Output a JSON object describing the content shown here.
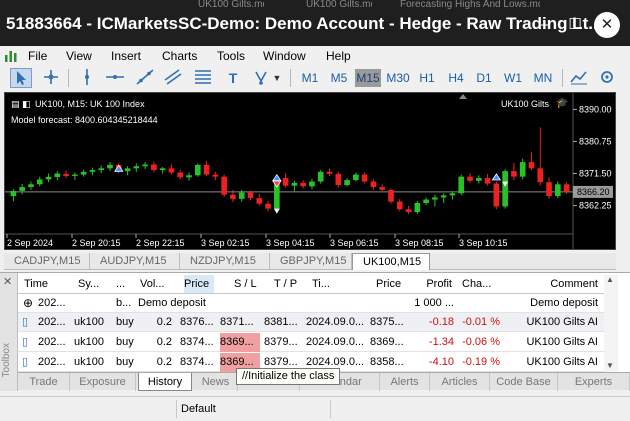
{
  "window": {
    "title": "51883664 - ICMarketsSC-Demo: Demo Account - Hedge - Raw Trading Lt...",
    "background_tabs": [
      "UK100 Gilts.mq5",
      "UK100 Gilts.mq5",
      "Forecasting Highs And Lows.mq5"
    ],
    "minimize": "–",
    "maximize": "☐",
    "close": "✕"
  },
  "menu": [
    "File",
    "View",
    "Insert",
    "Charts",
    "Tools",
    "Window",
    "Help"
  ],
  "toolbar": {
    "tools": [
      "cursor-icon",
      "crosshair-icon",
      "vertical-line-icon",
      "horizontal-line-icon",
      "trendline-icon",
      "channels-icon",
      "fibonacci-icon",
      "text-icon",
      "shapes-icon"
    ],
    "timeframes": [
      "M1",
      "M5",
      "M15",
      "M30",
      "H1",
      "H4",
      "D1",
      "W1",
      "MN"
    ],
    "selected_timeframe": "M15"
  },
  "chart": {
    "header": "UK100, M15:  UK 100 Index",
    "forecast": "Model forecast: 8400.604345218444",
    "expert": "UK100 Gilts",
    "current_price": "8366.20",
    "colors": {
      "bull": "#28c228",
      "bear": "#ee2020",
      "background": "#000000",
      "bid_line": "#8a8a8a"
    }
  },
  "chart_data": {
    "type": "candlestick",
    "symbol": "UK100",
    "timeframe": "M15",
    "y_ticks": [
      8390.0,
      8380.75,
      8371.5,
      8362.25
    ],
    "x_ticks": [
      "2 Sep 2024",
      "2 Sep 20:15",
      "2 Sep 22:15",
      "3 Sep 02:15",
      "3 Sep 04:15",
      "3 Sep 06:15",
      "3 Sep 08:15",
      "3 Sep 10:15"
    ],
    "ylim": [
      8355.5,
      8393.0
    ],
    "last": 8366.2,
    "candles": [
      [
        8365.0,
        8367.0,
        8363.5,
        8366.5
      ],
      [
        8366.5,
        8368.5,
        8365.5,
        8367.6
      ],
      [
        8367.6,
        8369.2,
        8366.8,
        8368.4
      ],
      [
        8368.4,
        8370.6,
        8367.8,
        8369.8
      ],
      [
        8369.8,
        8371.5,
        8369.0,
        8370.5
      ],
      [
        8370.5,
        8372.2,
        8369.6,
        8371.5
      ],
      [
        8371.4,
        8372.4,
        8370.2,
        8370.8
      ],
      [
        8370.8,
        8371.8,
        8369.6,
        8371.2
      ],
      [
        8371.2,
        8372.6,
        8370.6,
        8372.0
      ],
      [
        8372.0,
        8373.2,
        8371.0,
        8372.5
      ],
      [
        8372.5,
        8373.8,
        8371.6,
        8373.0
      ],
      [
        8373.0,
        8374.8,
        8372.2,
        8374.0
      ],
      [
        8374.0,
        8374.6,
        8371.6,
        8372.2
      ],
      [
        8372.2,
        8373.6,
        8371.0,
        8373.0
      ],
      [
        8373.0,
        8374.4,
        8372.0,
        8373.6
      ],
      [
        8373.6,
        8374.8,
        8372.8,
        8374.1
      ],
      [
        8374.1,
        8375.0,
        8371.8,
        8372.5
      ],
      [
        8372.5,
        8373.4,
        8371.5,
        8373.0
      ],
      [
        8373.0,
        8374.2,
        8371.2,
        8371.8
      ],
      [
        8371.8,
        8372.6,
        8369.8,
        8370.4
      ],
      [
        8370.4,
        8371.8,
        8369.4,
        8371.0
      ],
      [
        8371.0,
        8374.4,
        8370.6,
        8374.0
      ],
      [
        8374.0,
        8375.2,
        8370.8,
        8371.2
      ],
      [
        8371.2,
        8372.0,
        8369.6,
        8370.6
      ],
      [
        8370.6,
        8371.2,
        8364.8,
        8365.4
      ],
      [
        8365.4,
        8366.8,
        8363.2,
        8364.2
      ],
      [
        8364.2,
        8366.8,
        8363.4,
        8366.0
      ],
      [
        8366.0,
        8366.6,
        8363.8,
        8364.4
      ],
      [
        8364.4,
        8365.6,
        8362.2,
        8362.8
      ],
      [
        8362.8,
        8363.6,
        8360.6,
        8361.4
      ],
      [
        8361.4,
        8370.8,
        8360.8,
        8370.2
      ],
      [
        8370.2,
        8371.6,
        8367.4,
        8368.0
      ],
      [
        8368.0,
        8369.4,
        8366.4,
        8368.8
      ],
      [
        8368.8,
        8369.6,
        8367.2,
        8367.8
      ],
      [
        8367.8,
        8370.0,
        8367.0,
        8369.2
      ],
      [
        8369.2,
        8372.6,
        8368.6,
        8372.0
      ],
      [
        8372.0,
        8373.0,
        8370.8,
        8371.4
      ],
      [
        8371.4,
        8372.0,
        8367.4,
        8368.2
      ],
      [
        8368.2,
        8370.2,
        8367.8,
        8369.6
      ],
      [
        8369.6,
        8371.8,
        8369.2,
        8371.2
      ],
      [
        8371.2,
        8371.8,
        8368.6,
        8369.2
      ],
      [
        8369.2,
        8369.8,
        8366.8,
        8367.6
      ],
      [
        8367.6,
        8368.4,
        8366.2,
        8366.8
      ],
      [
        8366.8,
        8367.2,
        8362.8,
        8363.4
      ],
      [
        8363.4,
        8364.2,
        8360.6,
        8361.2
      ],
      [
        8361.2,
        8362.2,
        8359.8,
        8360.4
      ],
      [
        8360.4,
        8363.6,
        8359.8,
        8363.0
      ],
      [
        8363.0,
        8364.6,
        8362.4,
        8364.0
      ],
      [
        8364.0,
        8365.4,
        8362.0,
        8364.6
      ],
      [
        8364.6,
        8365.8,
        8363.0,
        8365.2
      ],
      [
        8365.2,
        8366.4,
        8364.0,
        8365.8
      ],
      [
        8365.8,
        8371.2,
        8365.2,
        8370.6
      ],
      [
        8370.6,
        8371.6,
        8368.8,
        8369.4
      ],
      [
        8369.4,
        8371.0,
        8368.6,
        8370.2
      ],
      [
        8370.2,
        8371.4,
        8368.0,
        8368.6
      ],
      [
        8368.6,
        8369.2,
        8361.2,
        8362.0
      ],
      [
        8362.0,
        8372.8,
        8361.4,
        8372.2
      ],
      [
        8372.2,
        8374.6,
        8369.6,
        8370.6
      ],
      [
        8370.6,
        8375.8,
        8369.8,
        8374.8
      ],
      [
        8374.8,
        8377.6,
        8372.4,
        8373.0
      ],
      [
        8373.0,
        8384.8,
        8368.0,
        8369.0
      ],
      [
        8369.0,
        8370.4,
        8364.2,
        8365.0
      ],
      [
        8365.0,
        8369.2,
        8364.4,
        8368.4
      ],
      [
        8368.4,
        8369.0,
        8365.6,
        8366.2
      ]
    ],
    "trade_markers": [
      {
        "candle": 12,
        "price": 8373.0,
        "type": "buy"
      },
      {
        "candle": 30,
        "price": 8370.3,
        "type": "buy"
      },
      {
        "candle": 30,
        "price": 8368.5,
        "type": "sell"
      },
      {
        "candle": 30,
        "price": 8360.8,
        "type": "close"
      },
      {
        "candle": 55,
        "price": 8370.5,
        "type": "buy"
      },
      {
        "candle": 56,
        "price": 8368.6,
        "type": "close"
      }
    ]
  },
  "chart_tabs": [
    "CADJPY,M15",
    "AUDJPY,M15",
    "NZDJPY,M15",
    "GBPJPY,M15",
    "UK100,M15"
  ],
  "chart_tabs_active": 4,
  "toolbox": {
    "side_label": "Toolbox",
    "columns": [
      "Time",
      "Sy...",
      "...",
      "Vol...",
      "Price",
      "S / L",
      "T / P",
      "Ti...",
      "Price",
      "Profit",
      "Cha...",
      "Comment"
    ],
    "deposit_row": {
      "time": "202...",
      "type": "b...",
      "text": "Demo deposit",
      "profit": "1 000 ...",
      "comment": "Demo deposit"
    },
    "rows": [
      {
        "time": "202...",
        "symbol": "uk100",
        "type": "buy",
        "volume": "0.2",
        "price": "8376...",
        "sl": "8371...",
        "tp": "8381...",
        "close_time": "2024.09.0...",
        "close_price": "8375...",
        "profit": "-0.18",
        "change": "-0.01 %",
        "comment": "UK100 Gilts AI"
      },
      {
        "time": "202...",
        "symbol": "uk100",
        "type": "buy",
        "volume": "0.2",
        "price": "8374...",
        "sl": "8369...",
        "tp": "8379...",
        "close_time": "2024.09.0...",
        "close_price": "8369...",
        "profit": "-1.34",
        "change": "-0.06 %",
        "comment": "UK100 Gilts AI"
      },
      {
        "time": "202...",
        "symbol": "uk100",
        "type": "buy",
        "volume": "0.2",
        "price": "8374...",
        "sl": "8369...",
        "tp": "8379...",
        "close_time": "2024.09.0...",
        "close_price": "8358...",
        "profit": "-4.10",
        "change": "-0.19 %",
        "comment": "UK100 Gilts AI"
      }
    ],
    "tabs": [
      "Trade",
      "Exposure",
      "History",
      "News",
      "Mailbox",
      "Calendar",
      "Alerts",
      "Articles",
      "Code Base",
      "Experts"
    ],
    "active_tab": "History",
    "tooltip": "//Initialize the class"
  },
  "status": {
    "profile": "Default"
  }
}
